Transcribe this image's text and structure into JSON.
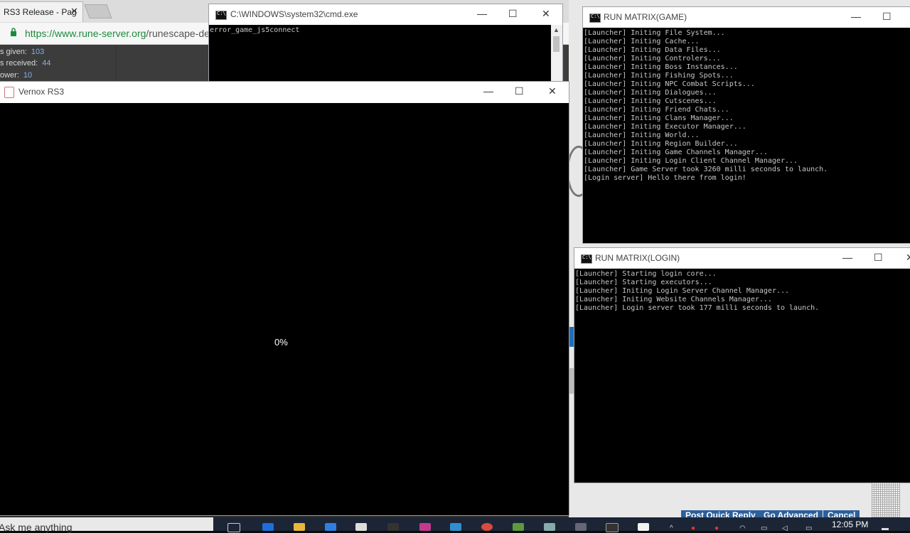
{
  "browser": {
    "tab_title": "RS3 Release - Pag",
    "tab_close": "✕",
    "url_secure": "https://www.rune-server.org",
    "url_rest": "/runescape-de",
    "stats": [
      {
        "label": "s given:",
        "value": "103"
      },
      {
        "label": "s received:",
        "value": "44"
      },
      {
        "label": "ower:",
        "value": "10"
      }
    ],
    "bottom_buttons": [
      "Post Quick Reply",
      "Go Advanced",
      "Cancel"
    ]
  },
  "cmd_window": {
    "title": "C:\\WINDOWS\\system32\\cmd.exe",
    "text": "error_game_js5connect"
  },
  "game_client": {
    "title": "Vernox RS3",
    "progress_text": "0%"
  },
  "matrix_game": {
    "title": "RUN MATRIX(GAME)",
    "log": "[Launcher] Initing File System...\n[Launcher] Initing Cache...\n[Launcher] Initing Data Files...\n[Launcher] Initing Controlers...\n[Launcher] Initing Boss Instances...\n[Launcher] Initing Fishing Spots...\n[Launcher] Initing NPC Combat Scripts...\n[Launcher] Initing Dialogues...\n[Launcher] Initing Cutscenes...\n[Launcher] Initing Friend Chats...\n[Launcher] Initing Clans Manager...\n[Launcher] Initing Executor Manager...\n[Launcher] Initing World...\n[Launcher] Initing Region Builder...\n[Launcher] Initing Game Channels Manager...\n[Launcher] Initing Login Client Channel Manager...\n[Launcher] Game Server took 3260 milli seconds to launch.\n[Login server] Hello there from login!"
  },
  "matrix_login": {
    "title": "RUN MATRIX(LOGIN)",
    "log": "[Launcher] Starting login core...\n[Launcher] Starting executors...\n[Launcher] Initing Login Server Channel Manager...\n[Launcher] Initing Website Channels Manager...\n[Launcher] Login server took 177 milli seconds to launch."
  },
  "window_controls": {
    "minimize": "—",
    "maximize": "☐",
    "close": "✕"
  },
  "taskbar": {
    "search_text": "Ask me anything",
    "clock": "12:05 PM"
  }
}
